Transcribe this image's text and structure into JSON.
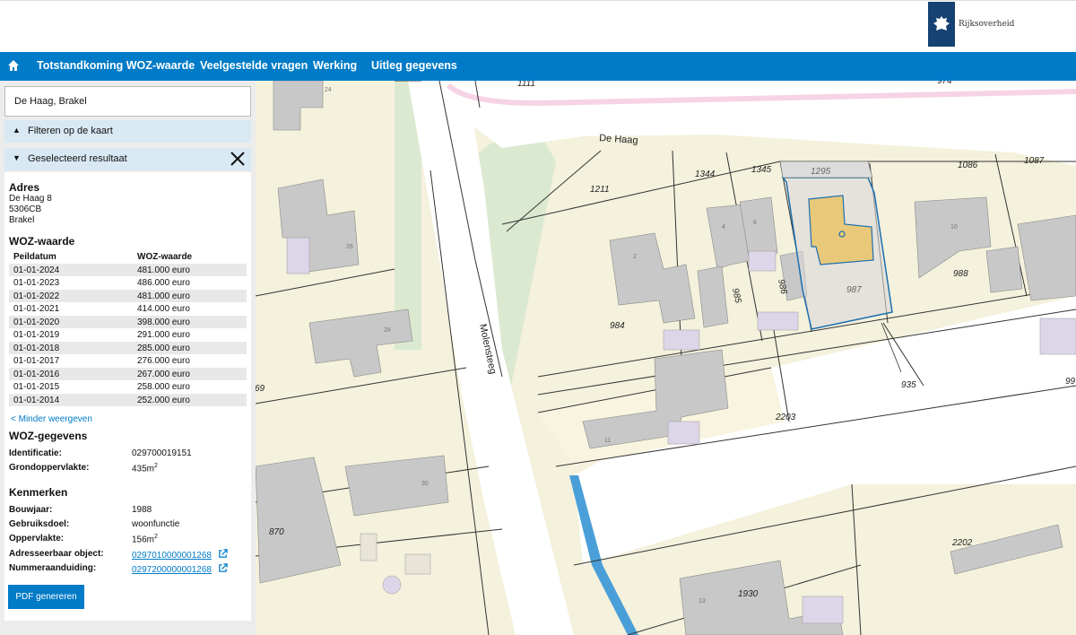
{
  "header": {
    "logo_text": "Rijksoverheid"
  },
  "nav": {
    "home_icon": "home-icon",
    "items": [
      {
        "label": "Totstandkoming WOZ-waarde"
      },
      {
        "label": "Veelgestelde vragen"
      },
      {
        "label": "Werking"
      },
      {
        "label": "Uitleg gegevens"
      }
    ]
  },
  "panel": {
    "search_value": "De Haag, Brakel",
    "filter_label": "Filteren op de kaart",
    "selected_label": "Geselecteerd resultaat",
    "adres": {
      "heading": "Adres",
      "line1": "De Haag 8",
      "line2": "5306CB",
      "line3": "Brakel"
    },
    "woz": {
      "heading": "WOZ-waarde",
      "col_date": "Peildatum",
      "col_value": "WOZ-waarde",
      "rows": [
        {
          "date": "01-01-2024",
          "value": "481.000 euro"
        },
        {
          "date": "01-01-2023",
          "value": "486.000 euro"
        },
        {
          "date": "01-01-2022",
          "value": "481.000 euro"
        },
        {
          "date": "01-01-2021",
          "value": "414.000 euro"
        },
        {
          "date": "01-01-2020",
          "value": "398.000 euro"
        },
        {
          "date": "01-01-2019",
          "value": "291.000 euro"
        },
        {
          "date": "01-01-2018",
          "value": "285.000 euro"
        },
        {
          "date": "01-01-2017",
          "value": "276.000 euro"
        },
        {
          "date": "01-01-2016",
          "value": "267.000 euro"
        },
        {
          "date": "01-01-2015",
          "value": "258.000 euro"
        },
        {
          "date": "01-01-2014",
          "value": "252.000 euro"
        }
      ],
      "less_link": "< Minder weergeven"
    },
    "gegevens": {
      "heading": "WOZ-gegevens",
      "ident_label": "Identificatie:",
      "ident_value": "029700019151",
      "grond_label": "Grondoppervlakte:",
      "grond_value": "435m",
      "grond_sup": "2"
    },
    "kenmerken": {
      "heading": "Kenmerken",
      "bouwjaar_label": "Bouwjaar:",
      "bouwjaar_value": "1988",
      "gebruik_label": "Gebruiksdoel:",
      "gebruik_value": "woonfunctie",
      "opp_label": "Oppervlakte:",
      "opp_value": "156m",
      "opp_sup": "2",
      "adr_label": "Adresseerbaar object:",
      "adr_value": "0297010000001268",
      "num_label": "Nummeraanduiding:",
      "num_value": "0297200000001268"
    },
    "pdf_button": "PDF genereren"
  },
  "map": {
    "street_labels": {
      "haag": "De Haag",
      "molensteeg": "Molensteeg"
    },
    "parcel_numbers": {
      "p1111": "1111",
      "p974": "974",
      "p1211": "1211",
      "p1344": "1344",
      "p1345": "1345",
      "p1295": "1295",
      "p1086": "1086",
      "p1087": "1087",
      "p984": "984",
      "p985": "985",
      "p986": "986",
      "p987": "987",
      "p988": "988",
      "p935": "935",
      "p2203": "2203",
      "p2202": "2202",
      "p870": "870",
      "p1930": "1930",
      "p69": "69",
      "p99": "99"
    },
    "house_numbers": {
      "h24": "24",
      "h26": "26",
      "h28": "28",
      "h30": "30",
      "h2": "2",
      "h4": "4",
      "h6": "6",
      "h10": "10",
      "h11": "11",
      "h13": "13"
    },
    "colors": {
      "parcel": "#f4f1dc",
      "road": "#ffffff",
      "building": "#c8c8c8",
      "selected": "#e8c97a",
      "water": "#4a9fd8",
      "green": "#dbe9d1"
    }
  }
}
